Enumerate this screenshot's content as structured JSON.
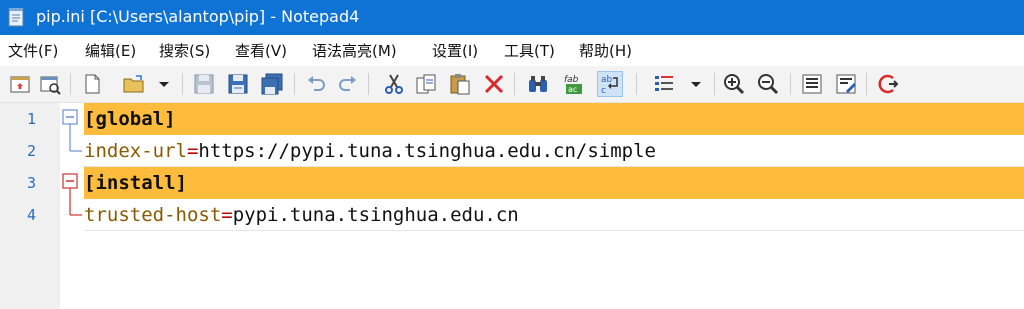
{
  "window": {
    "title": "pip.ini [C:\\Users\\alantop\\pip] - Notepad4",
    "icon": "notepad-icon"
  },
  "menu": [
    {
      "label": "文件(F)"
    },
    {
      "label": "编辑(E)"
    },
    {
      "label": "搜索(S)"
    },
    {
      "label": "查看(V)"
    },
    {
      "label": "语法高亮(M)"
    },
    {
      "label": "设置(I)"
    },
    {
      "label": "工具(T)"
    },
    {
      "label": "帮助(H)"
    }
  ],
  "toolbar_icons": [
    "new-window-icon",
    "open-browser-icon",
    "new-file-icon",
    "open-folder-icon",
    "dropdown-arrow-icon",
    "save-icon",
    "save-as-icon",
    "save-copy-icon",
    "undo-icon",
    "redo-icon",
    "cut-icon",
    "copy-icon",
    "paste-icon",
    "delete-icon",
    "find-icon",
    "replace-icon",
    "word-wrap-icon",
    "encoding-icon",
    "dropdown-arrow-icon",
    "zoom-in-icon",
    "zoom-out-icon",
    "scheme-icon",
    "customize-scheme-icon",
    "exit-icon"
  ],
  "editor": {
    "lines": [
      {
        "number": "1",
        "type": "section",
        "text": "[global]"
      },
      {
        "number": "2",
        "type": "kv",
        "key": "index-url",
        "eq": "=",
        "value": "https://pypi.tuna.tsinghua.edu.cn/simple"
      },
      {
        "number": "3",
        "type": "section",
        "text": "[install]"
      },
      {
        "number": "4",
        "type": "kv",
        "key": "trusted-host",
        "eq": "=",
        "value": "pypi.tuna.tsinghua.edu.cn"
      }
    ]
  },
  "colors": {
    "titlebar": "#0f73d6",
    "section_highlight": "#fdbc3c",
    "key": "#8a5a00",
    "equals": "#c00000",
    "line_number": "#2b6bbf"
  }
}
